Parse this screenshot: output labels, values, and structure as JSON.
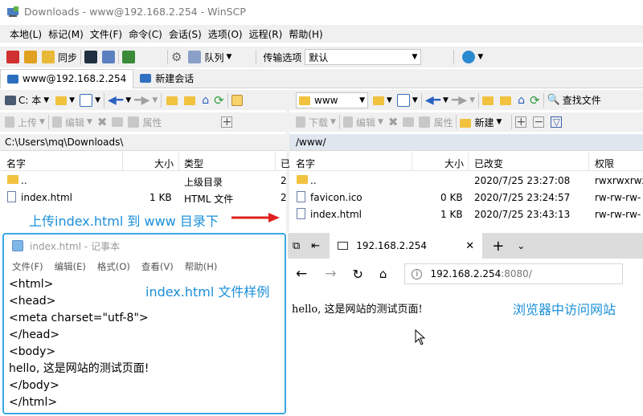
{
  "window": {
    "title": "Downloads - www@192.168.2.254 - WinSCP"
  },
  "menu": [
    "本地(L)",
    "标记(M)",
    "文件(F)",
    "命令(C)",
    "会话(S)",
    "选项(O)",
    "远程(R)",
    "帮助(H)"
  ],
  "toolbar": {
    "sync_label": "同步",
    "queue_label": "队列",
    "transfer_label": "传输选项",
    "transfer_value": "默认"
  },
  "tabs": {
    "session_label": "www@192.168.2.254",
    "new_session_label": "新建会话"
  },
  "local": {
    "drive": "C: 本",
    "upload": "上传",
    "edit": "编辑",
    "properties": "属性",
    "path": "C:\\Users\\mq\\Downloads\\",
    "columns": [
      "名字",
      "大小",
      "类型",
      "已"
    ],
    "rows": [
      {
        "name": "..",
        "size": "",
        "type": "上级目录",
        "extra": "2"
      },
      {
        "name": "index.html",
        "size": "1 KB",
        "type": "HTML 文件",
        "extra": "2"
      }
    ]
  },
  "remote": {
    "dir": "www",
    "download": "下载",
    "edit": "编辑",
    "properties": "属性",
    "new": "新建",
    "find": "查找文件",
    "path": "/www/",
    "columns": [
      "名字",
      "大小",
      "已改变",
      "权限"
    ],
    "rows": [
      {
        "name": "..",
        "size": "",
        "changed": "2020/7/25 23:27:08",
        "perm": "rwxrwxrwx"
      },
      {
        "name": "favicon.ico",
        "size": "0 KB",
        "changed": "2020/7/25 23:24:57",
        "perm": "rw-rw-rw-"
      },
      {
        "name": "index.html",
        "size": "1 KB",
        "changed": "2020/7/25 23:43:13",
        "perm": "rw-rw-rw-"
      }
    ]
  },
  "annotations": {
    "upload": "上传index.html 到 www 目录下",
    "sample": "index.html 文件样例",
    "browser": "浏览器中访问网站"
  },
  "notepad": {
    "title": "index.html - 记事本",
    "menu": [
      "文件(F)",
      "编辑(E)",
      "格式(O)",
      "查看(V)",
      "帮助(H)"
    ],
    "lines": [
      "<html>",
      "<head>",
      "<meta charset=\"utf-8\">",
      "</head>",
      "<body>",
      "hello, 这是网站的测试页面!",
      "</body>",
      "</html>"
    ]
  },
  "browser": {
    "tab_title": "192.168.2.254",
    "url_host": "192.168.2.254",
    "url_rest": ":8080/",
    "content": "hello, 这是网站的测试页面!"
  }
}
